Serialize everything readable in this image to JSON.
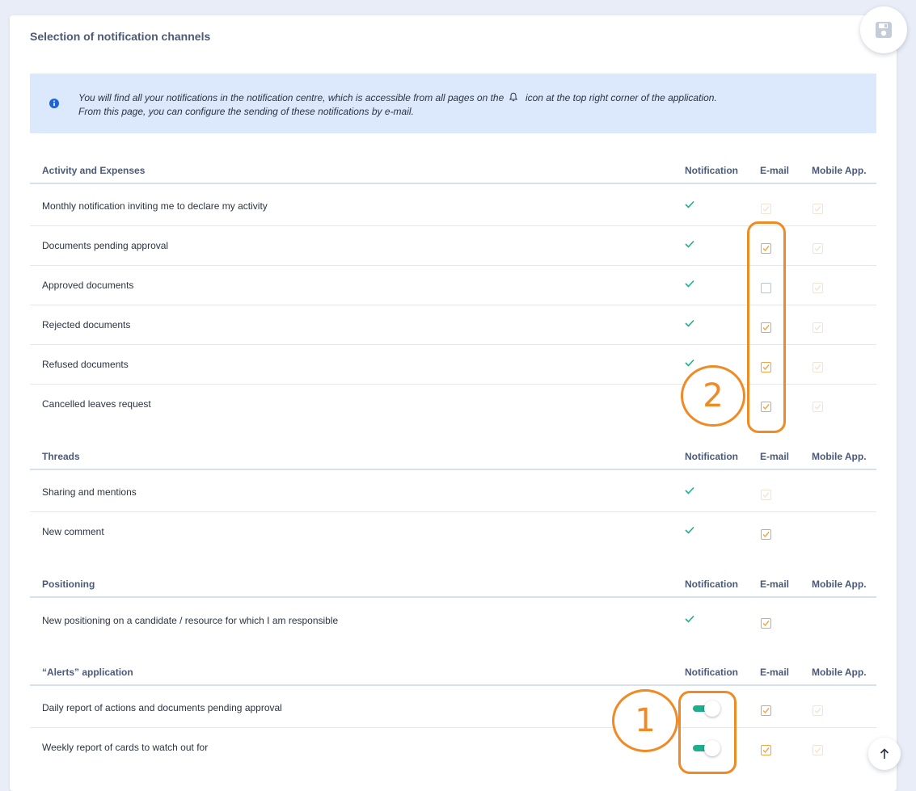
{
  "page": {
    "title": "Selection of notification channels",
    "info_line1_a": "You will find all your notifications in the notification centre, which is accessible from all pages on the",
    "info_line1_b": "icon at the top right corner of the application.",
    "info_line2": "From this page, you can configure the sending of these notifications by e-mail."
  },
  "columns": {
    "notification": "Notification",
    "email": "E-mail",
    "mobile": "Mobile App."
  },
  "sections": [
    {
      "name": "Activity and Expenses",
      "rows": [
        {
          "label": "Monthly notification inviting me to declare my activity",
          "email": "checked-disabled",
          "mobile": "checked-disabled"
        },
        {
          "label": "Documents pending approval",
          "email": "checked",
          "mobile": "checked-disabled"
        },
        {
          "label": "Approved documents",
          "email": "unchecked",
          "mobile": "checked-disabled"
        },
        {
          "label": "Rejected documents",
          "email": "checked",
          "mobile": "checked-disabled"
        },
        {
          "label": "Refused documents",
          "email": "checked",
          "mobile": "checked-disabled"
        },
        {
          "label": "Cancelled leaves request",
          "email": "checked",
          "mobile": "checked-disabled"
        }
      ]
    },
    {
      "name": "Threads",
      "rows": [
        {
          "label": "Sharing and mentions",
          "email": "checked-disabled"
        },
        {
          "label": "New comment",
          "email": "checked"
        }
      ]
    },
    {
      "name": "Positioning",
      "rows": [
        {
          "label": "New positioning on a candidate / resource for which I am responsible",
          "email": "checked"
        }
      ]
    },
    {
      "name": "“Alerts” application",
      "rows": [
        {
          "label": "Daily report of actions and documents pending approval",
          "notification": "toggle-on",
          "email": "checked",
          "mobile": "checked-disabled"
        },
        {
          "label": "Weekly report of cards to watch out for",
          "notification": "toggle-on",
          "email": "checked",
          "mobile": "checked-disabled"
        }
      ]
    }
  ],
  "annotations": {
    "badge1": "1",
    "badge2": "2"
  },
  "colors": {
    "accent": "#f08a24",
    "checkbox": "#f1a443",
    "green": "#1fae8e",
    "header": "#4a5a78",
    "info_bg": "#dce8fc"
  },
  "icons": {
    "save": "floppy-disk-icon",
    "info": "info-icon",
    "bell": "bell-icon",
    "back_to_top": "arrow-up-icon"
  }
}
